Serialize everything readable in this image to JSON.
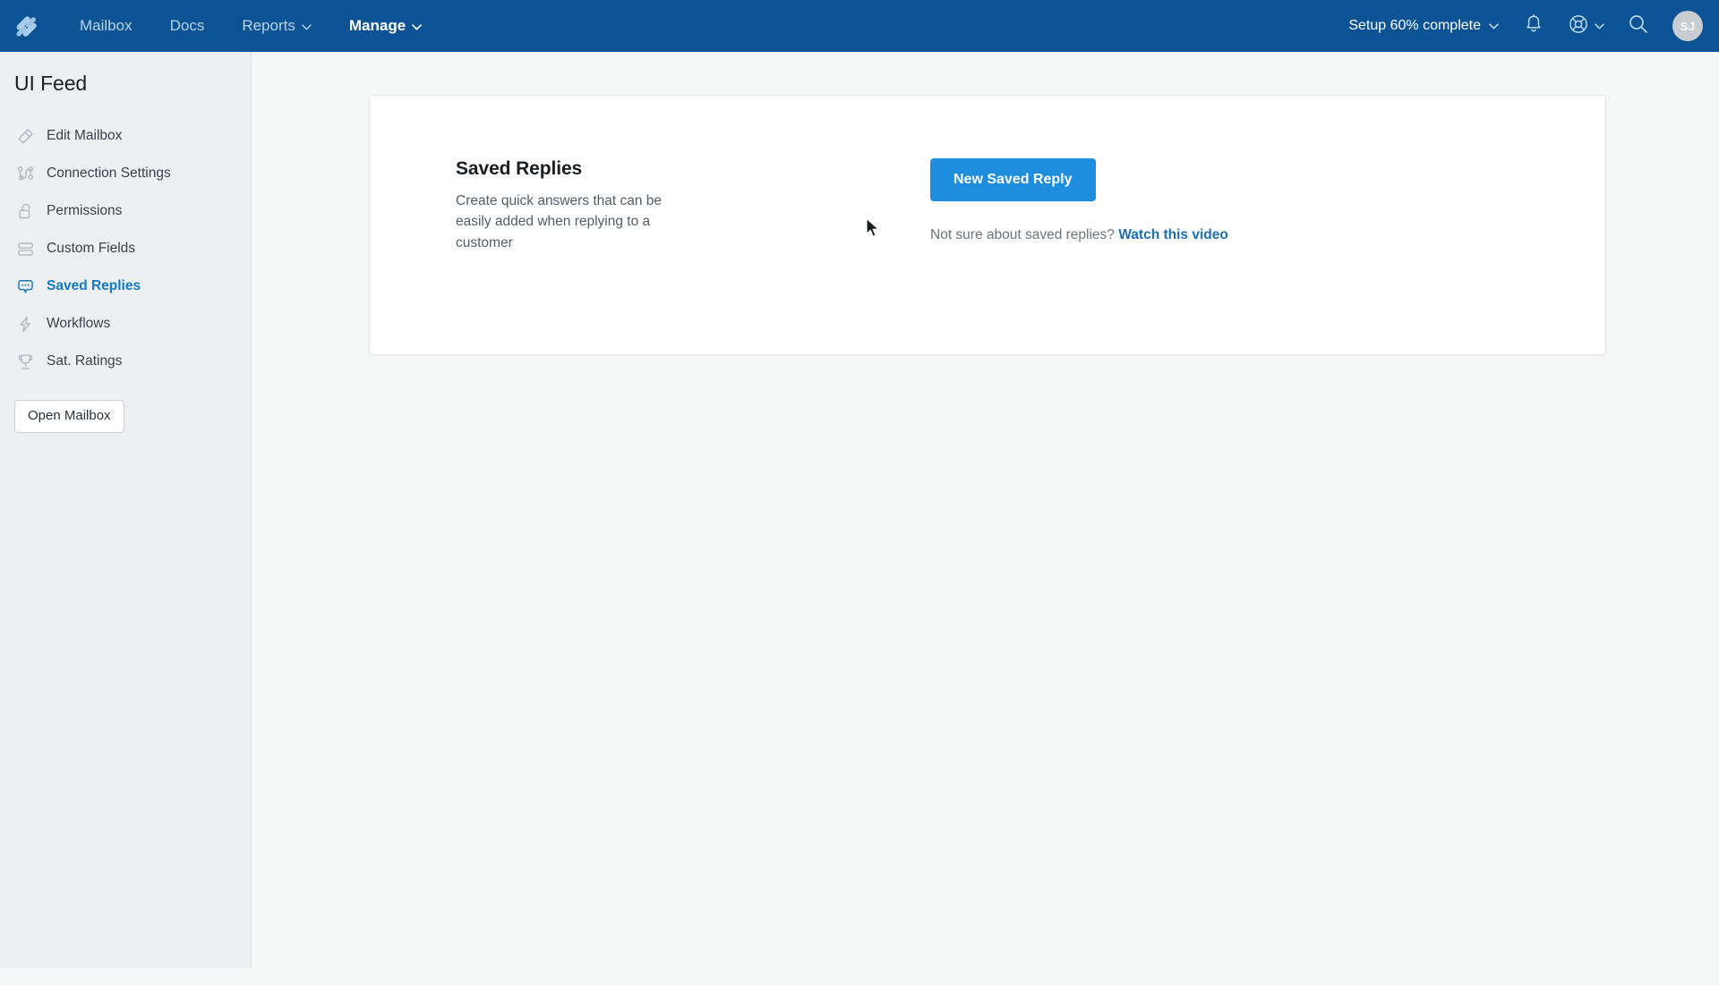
{
  "topnav": {
    "logo_name": "helpscout-logo",
    "links": [
      {
        "label": "Mailbox",
        "active": false,
        "caret": false
      },
      {
        "label": "Docs",
        "active": false,
        "caret": false
      },
      {
        "label": "Reports",
        "active": false,
        "caret": true
      },
      {
        "label": "Manage",
        "active": true,
        "caret": true
      }
    ],
    "setup_status": "Setup 60% complete",
    "caret_glyph": "⌄",
    "notifications_icon": "bell-icon",
    "help_icon": "lifesaver-icon",
    "search_icon": "search-icon",
    "avatar_initials": "SJ"
  },
  "sidebar": {
    "title": "UI Feed",
    "items": [
      {
        "label": "Edit Mailbox",
        "icon": "pencil-icon",
        "active": false
      },
      {
        "label": "Connection Settings",
        "icon": "connection-icon",
        "active": false
      },
      {
        "label": "Permissions",
        "icon": "unlock-icon",
        "active": false
      },
      {
        "label": "Custom Fields",
        "icon": "stacked-fields-icon",
        "active": false
      },
      {
        "label": "Saved Replies",
        "icon": "chat-bubble-icon",
        "active": true
      },
      {
        "label": "Workflows",
        "icon": "lightning-bolt-icon",
        "active": false
      },
      {
        "label": "Sat. Ratings",
        "icon": "trophy-icon",
        "active": false
      }
    ],
    "open_mailbox_label": "Open Mailbox"
  },
  "main": {
    "card": {
      "heading": "Saved Replies",
      "description": "Create quick answers that can be easily added when replying to a customer",
      "primary_button": "New Saved Reply",
      "help_prompt": "Not sure about saved replies?",
      "help_link": "Watch this video"
    }
  },
  "beacon": {
    "icon": "chat-beacon-icon",
    "color": "#6161cf"
  },
  "colors": {
    "topnav_bg": "#0c5396",
    "sidebar_bg": "#eeeff3",
    "main_bg": "#f6f7f7",
    "accent_blue": "#1f8dde",
    "active_link": "#1279c6",
    "link_blue": "#1f6fb2"
  }
}
